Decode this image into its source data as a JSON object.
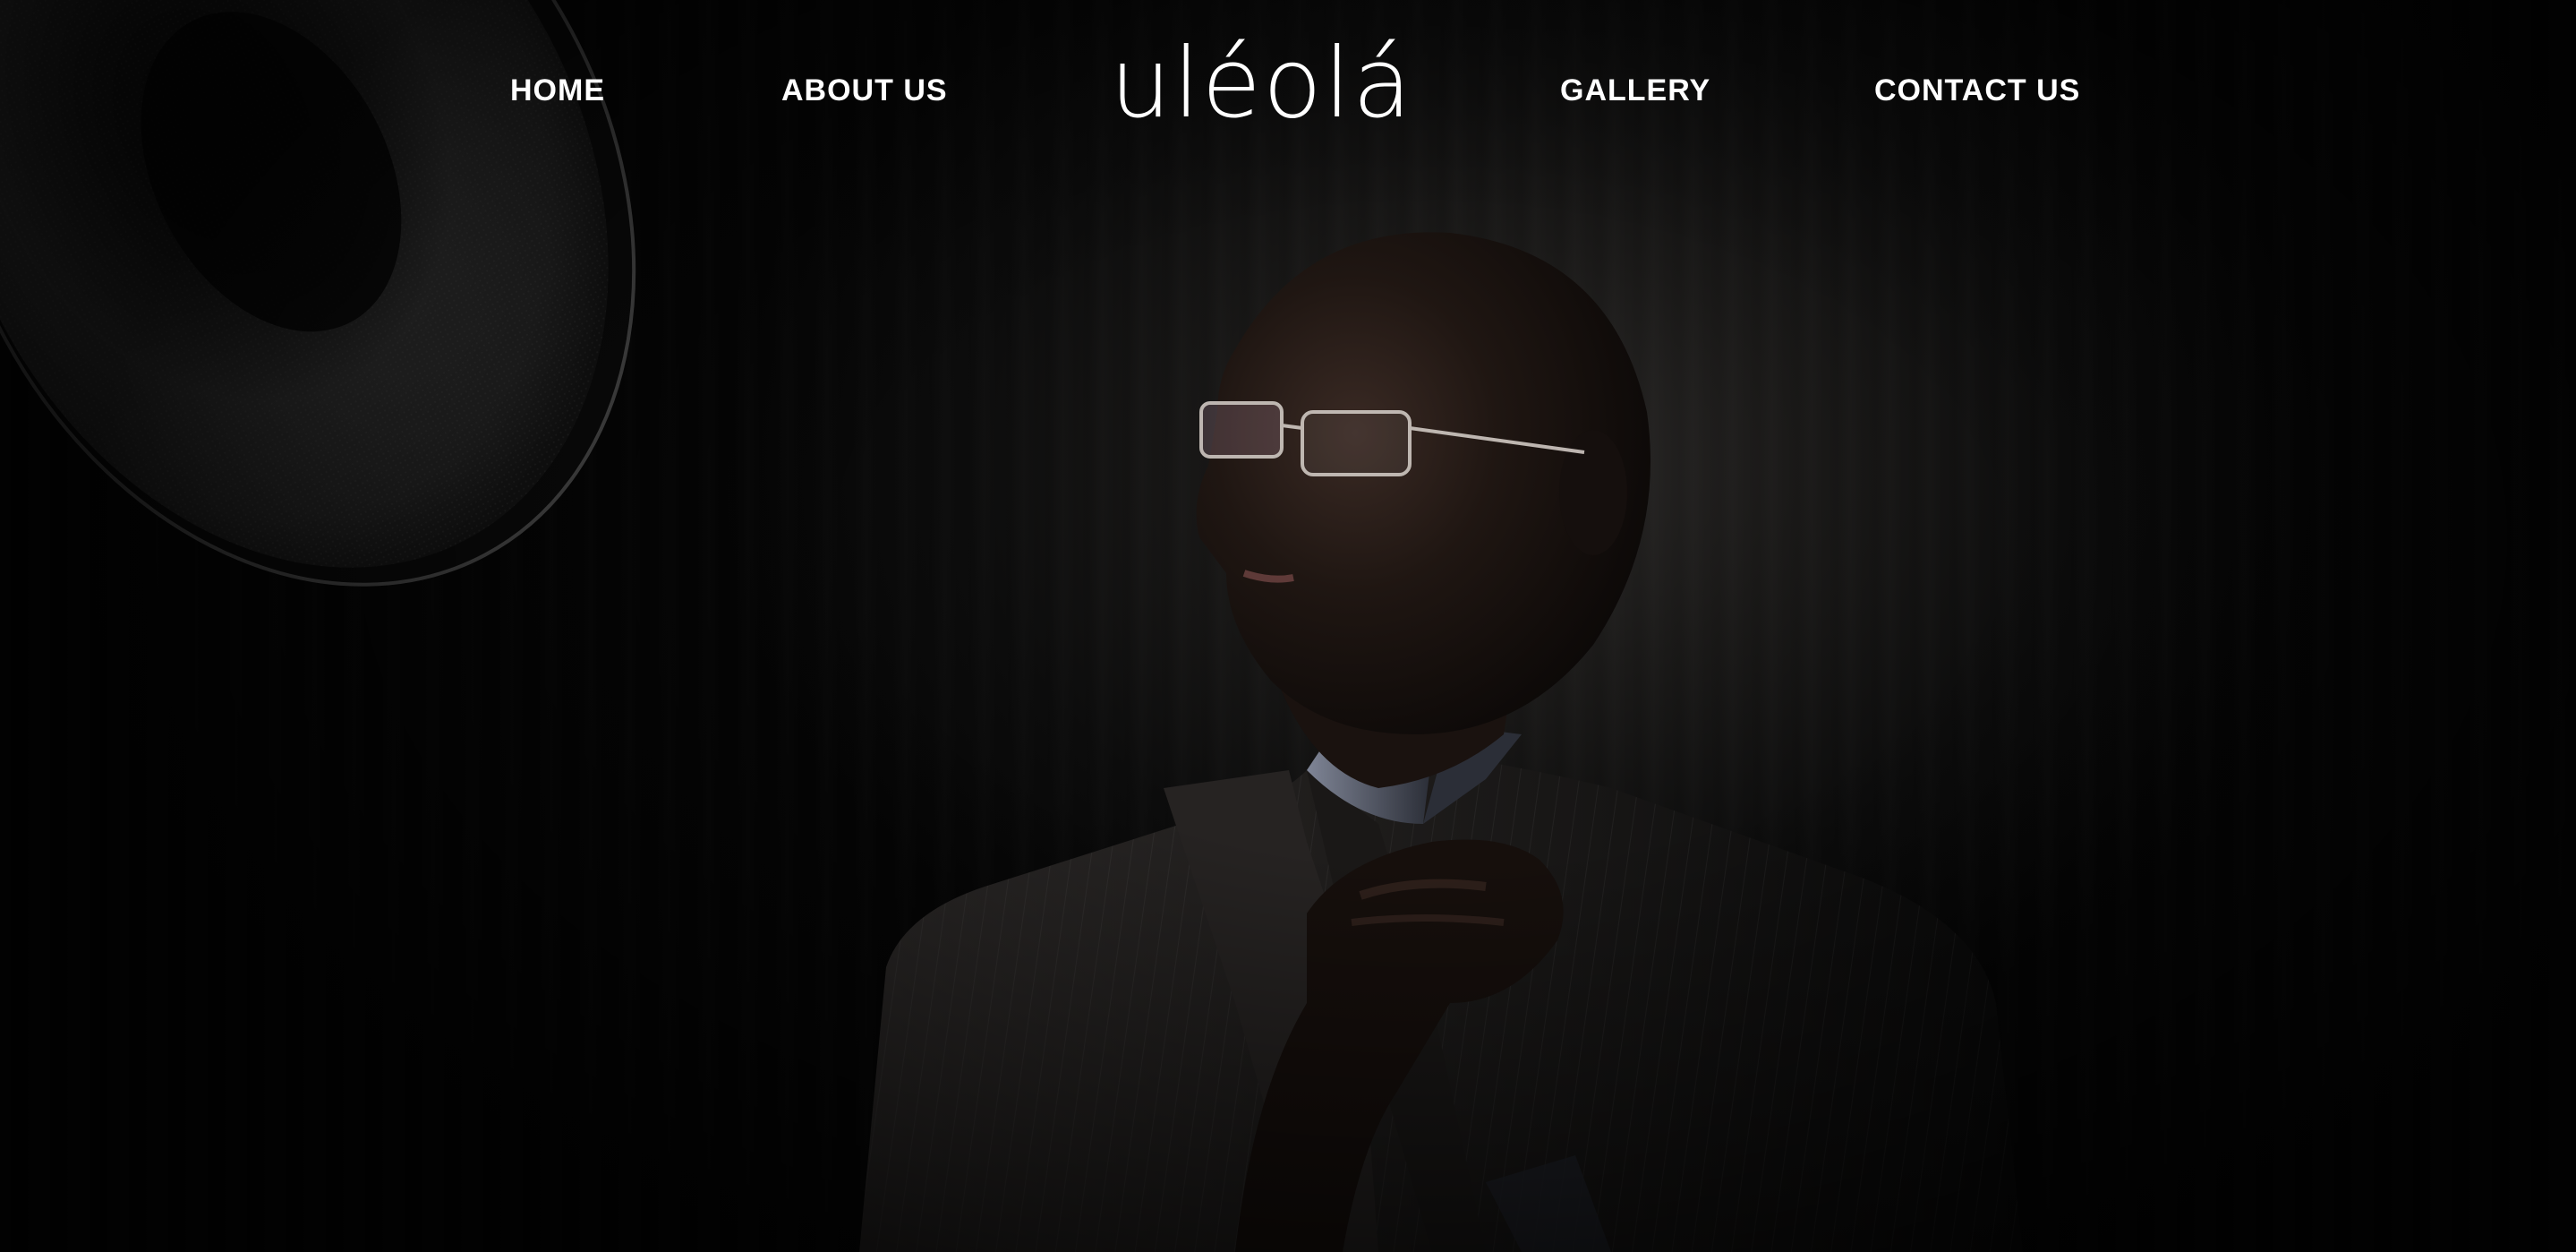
{
  "nav": {
    "home_label": "HOME",
    "about_label": "ABOUT US",
    "gallery_label": "GALLERY",
    "contact_label": "CONTACT US"
  },
  "logo": {
    "text": "uléolá"
  },
  "hero": {
    "image": "dark studio portrait of a man in glasses and pinstripe suit beside a softbox light"
  },
  "colors": {
    "background": "#050505",
    "nav_text": "#ffffff"
  }
}
